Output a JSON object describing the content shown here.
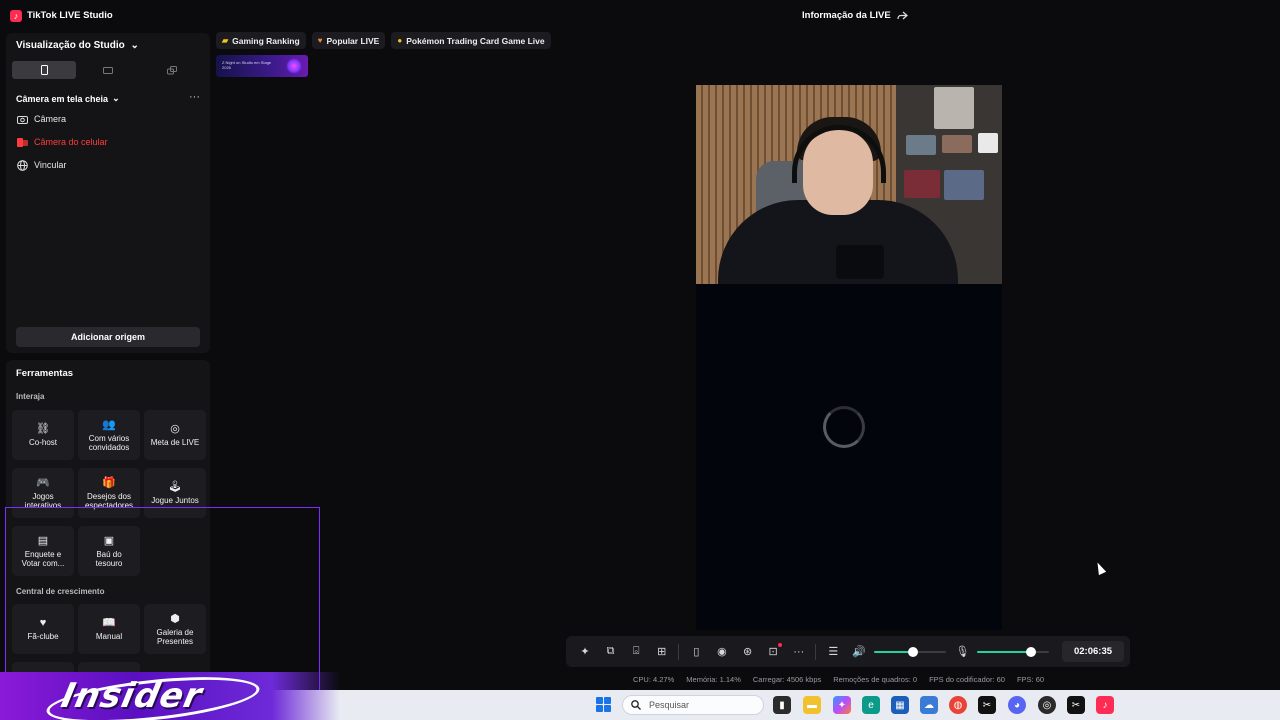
{
  "app": {
    "title": "TikTok LIVE Studio",
    "live_info": "Informação da LIVE"
  },
  "sidebar": {
    "studio_view": "Visualização do Studio",
    "camera_fullscreen": "Câmera em tela cheia",
    "sources": [
      {
        "label": "Câmera",
        "icon": "camera-icon"
      },
      {
        "label": "Câmera do celular",
        "icon": "phone-camera-icon"
      },
      {
        "label": "Vincular",
        "icon": "globe-icon"
      }
    ],
    "add_origin": "Adicionar origem"
  },
  "tools": {
    "title": "Ferramentas",
    "interact_label": "Interaja",
    "growth_label": "Central de crescimento",
    "interact_items": [
      {
        "label": "Co-host",
        "icon": "link-icon"
      },
      {
        "label": "Com vários convidados",
        "icon": "people-icon"
      },
      {
        "label": "Meta de LIVE",
        "icon": "target-icon"
      },
      {
        "label": "Jogos interativos",
        "icon": "gamepad-icon"
      },
      {
        "label": "Desejos dos espectadores",
        "icon": "gift-icon"
      },
      {
        "label": "Jogue Juntos",
        "icon": "joystick-icon"
      },
      {
        "label": "Enquete e Votar com...",
        "icon": "poll-icon"
      },
      {
        "label": "Baú do tesouro",
        "icon": "chest-icon"
      }
    ],
    "growth_items": [
      {
        "label": "Fã-clube",
        "icon": "heart-icon"
      },
      {
        "label": "Manual",
        "icon": "book-icon"
      },
      {
        "label": "Galeria de Presentes",
        "icon": "gift-gallery-icon"
      }
    ]
  },
  "chips": [
    {
      "label": "Gaming Ranking",
      "color": "#f5c518"
    },
    {
      "label": "Popular LIVE",
      "color": "#f08a3c"
    },
    {
      "label": "Pokémon Trading Card Game Live",
      "color": "#f5c518"
    }
  ],
  "banner_text": "Z Night on Studio em Stage 2026",
  "controls": {
    "timer": "02:06:35",
    "volume": 0.55,
    "mic": 0.75
  },
  "stats": {
    "cpu": "CPU: 4.27%",
    "memory": "Memória: 1.14%",
    "upload": "Carregar: 4506 kbps",
    "dropped": "Remoções de quadros: 0",
    "encoder_fps": "FPS do codificador: 60",
    "fps": "FPS: 60"
  },
  "overlay": {
    "brand": "Insider"
  },
  "taskbar": {
    "search_placeholder": "Pesquisar"
  },
  "colors": {
    "accent": "#fe2c55",
    "active_green": "#20d5a0",
    "highlight": "#7a2fff"
  }
}
